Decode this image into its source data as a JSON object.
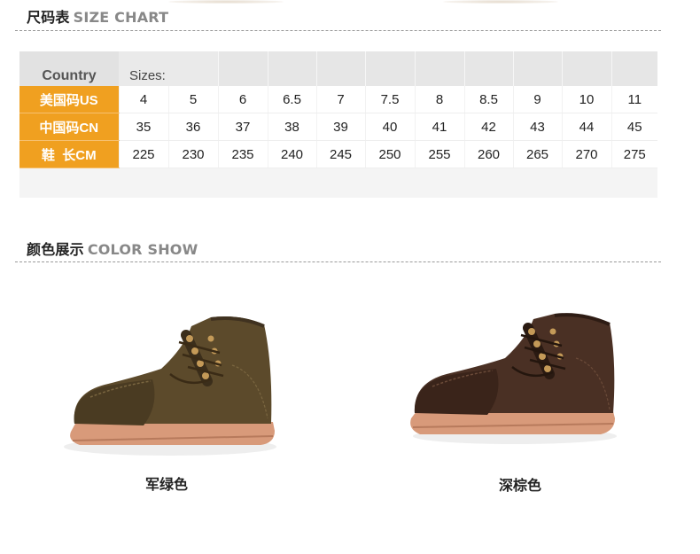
{
  "size_section": {
    "title_cn": "尺码表",
    "title_en": "SIZE CHART"
  },
  "size_table": {
    "corner": "Country",
    "header": "Sizes:",
    "rows": [
      {
        "label": "美国码US",
        "values": [
          "4",
          "5",
          "6",
          "6.5",
          "7",
          "7.5",
          "8",
          "8.5",
          "9",
          "10",
          "11"
        ]
      },
      {
        "label": "中国码CN",
        "values": [
          "35",
          "36",
          "37",
          "38",
          "39",
          "40",
          "41",
          "42",
          "43",
          "44",
          "45"
        ]
      },
      {
        "label": "鞋  长CM",
        "values": [
          "225",
          "230",
          "235",
          "240",
          "245",
          "250",
          "255",
          "260",
          "265",
          "270",
          "275"
        ]
      }
    ],
    "label_color": "#f0a020"
  },
  "color_section": {
    "title_cn": "颜色展示",
    "title_en": "COLOR SHOW"
  },
  "products": [
    {
      "caption": "军绿色",
      "color": "#5a4a2a"
    },
    {
      "caption": "深棕色",
      "color": "#4a3024"
    }
  ]
}
